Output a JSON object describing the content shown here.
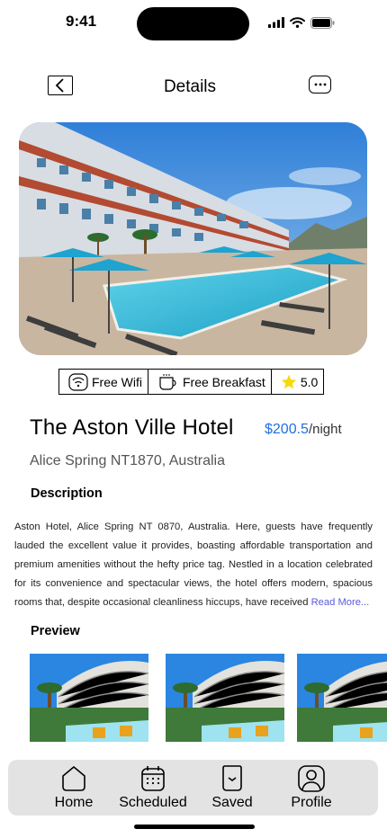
{
  "status_bar": {
    "time": "9:41"
  },
  "header": {
    "title": "Details"
  },
  "amenities": [
    {
      "icon": "wifi-icon",
      "label": "Free Wifi"
    },
    {
      "icon": "coffee-cup-icon",
      "label": "Free Breakfast"
    },
    {
      "icon": "star-icon",
      "label": "5.0"
    }
  ],
  "hotel": {
    "name": "The Aston Ville Hotel",
    "price": "$200.5",
    "price_unit": "/night",
    "location": "Alice Spring NT1870, Australia"
  },
  "description": {
    "heading": "Description",
    "text": "Aston Hotel, Alice Spring NT 0870, Australia. Here, guests have frequently lauded the excellent value it provides, boasting affordable transportation and premium amenities without the hefty price tag. Nestled in a location celebrated for its convenience and spectacular views, the hotel offers modern, spacious rooms that, despite occasional cleanliness hiccups, have received ",
    "read_more": "Read More..."
  },
  "preview": {
    "heading": "Preview"
  },
  "tab_bar": {
    "items": [
      {
        "label": "Home",
        "icon": "home-icon"
      },
      {
        "label": "Scheduled",
        "icon": "calendar-icon"
      },
      {
        "label": "Saved",
        "icon": "bookmark-icon"
      },
      {
        "label": "Profile",
        "icon": "profile-icon"
      }
    ]
  },
  "colors": {
    "accent": "#1f6fe0",
    "link": "#5a5ae0",
    "tab_bar_bg": "#e3e3e3",
    "star": "#f5d90a"
  }
}
